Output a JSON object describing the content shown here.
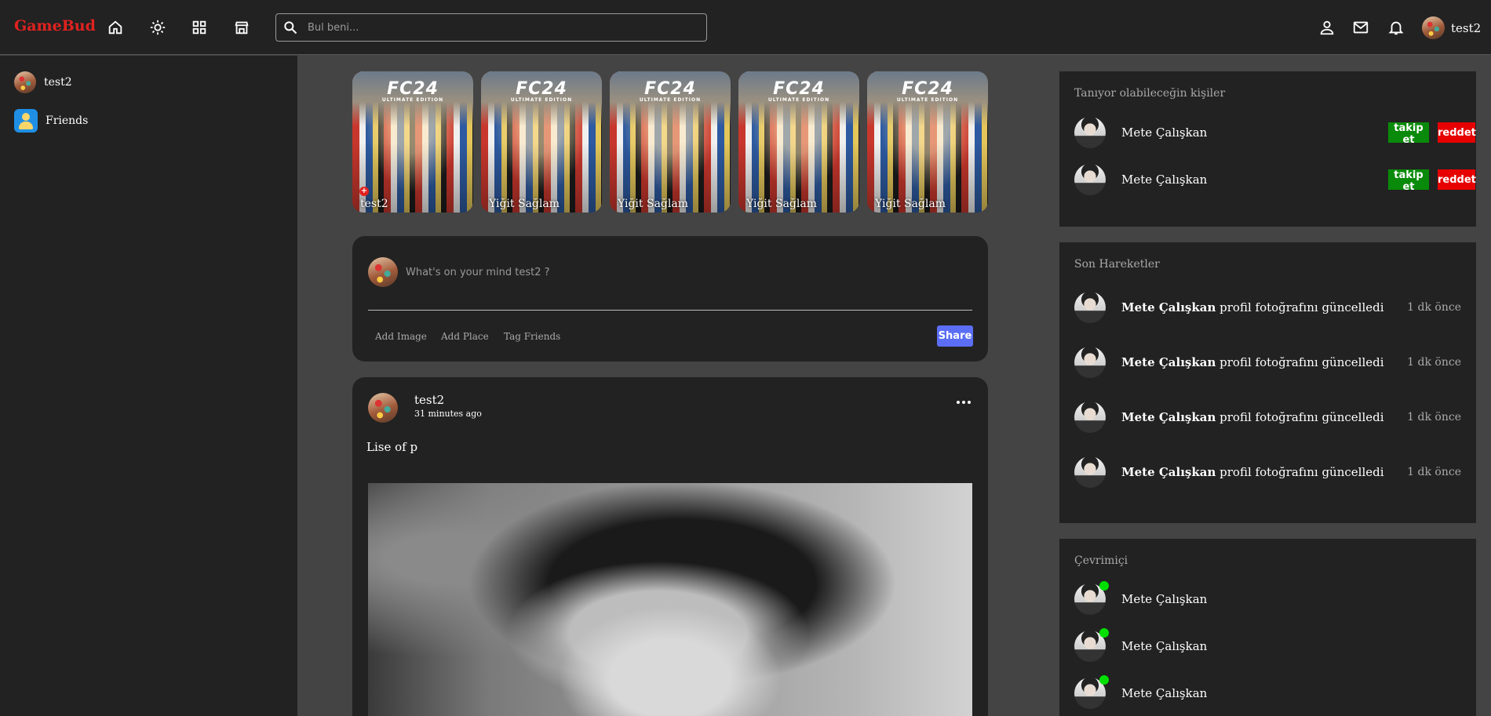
{
  "app": {
    "logo": "GameBud"
  },
  "nav": {
    "icons": [
      "home-icon",
      "sun-icon",
      "grid-icon",
      "store-icon"
    ],
    "search_placeholder": "Bul beni...",
    "right_icons": [
      "person-icon",
      "mail-icon",
      "bell-icon"
    ],
    "username": "test2"
  },
  "sidebar": {
    "items": [
      {
        "label": "test2",
        "icon": "avatar"
      },
      {
        "label": "Friends",
        "icon": "friends-icon"
      }
    ]
  },
  "stories": [
    {
      "name": "test2",
      "title": "FC24",
      "subtitle": "ULTIMATE EDITION"
    },
    {
      "name": "Yiğit Sağlam",
      "title": "FC24",
      "subtitle": "ULTIMATE EDITION"
    },
    {
      "name": "Yiğit Sağlam",
      "title": "FC24",
      "subtitle": "ULTIMATE EDITION"
    },
    {
      "name": "Yiğit Sağlam",
      "title": "FC24",
      "subtitle": "ULTIMATE EDITION"
    },
    {
      "name": "Yiğit Sağlam",
      "title": "FC24",
      "subtitle": "ULTIMATE EDITION"
    }
  ],
  "share": {
    "placeholder": "What's on your mind test2 ?",
    "options": [
      "Add Image",
      "Add Place",
      "Tag Friends"
    ],
    "button": "Share"
  },
  "post": {
    "user": "test2",
    "time": "31 minutes ago",
    "text": "Lise of p"
  },
  "suggestions": {
    "title": "Tanıyor olabileceğin kişiler",
    "follow_label": "takip et",
    "reject_label": "reddet",
    "people": [
      {
        "name": "Mete Çalışkan"
      },
      {
        "name": "Mete Çalışkan"
      }
    ]
  },
  "activities": {
    "title": "Son Hareketler",
    "items": [
      {
        "name": "Mete Çalışkan",
        "action": "profil fotoğrafını güncelledi",
        "ago": "1 dk önce"
      },
      {
        "name": "Mete Çalışkan",
        "action": "profil fotoğrafını güncelledi",
        "ago": "1 dk önce"
      },
      {
        "name": "Mete Çalışkan",
        "action": "profil fotoğrafını güncelledi",
        "ago": "1 dk önce"
      },
      {
        "name": "Mete Çalışkan",
        "action": "profil fotoğrafını güncelledi",
        "ago": "1 dk önce"
      }
    ]
  },
  "online": {
    "title": "Çevrimiçi",
    "status_color": "#00e000",
    "people": [
      {
        "name": "Mete Çalışkan"
      },
      {
        "name": "Mete Çalışkan"
      },
      {
        "name": "Mete Çalışkan"
      }
    ]
  },
  "colors": {
    "brand": "#e0221f",
    "share_button": "#5b6ef5",
    "follow": "#0a8a0a",
    "reject": "#e60000",
    "panel": "#222222",
    "background": "#444444"
  }
}
